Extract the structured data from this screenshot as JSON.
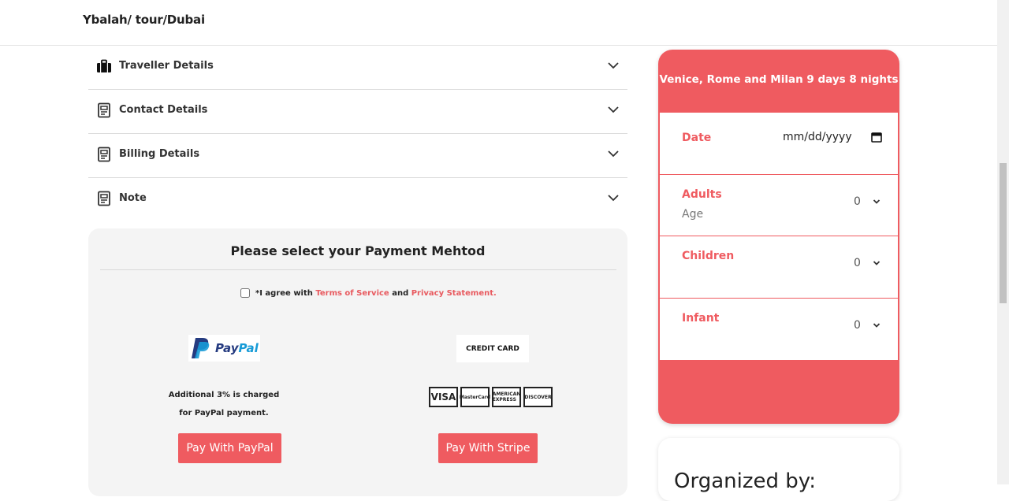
{
  "header": {
    "breadcrumb": "Ybalah/ tour/Dubai"
  },
  "accordion": [
    {
      "label": "Traveller Details",
      "icon": "suitcase-icon"
    },
    {
      "label": "Contact Details",
      "icon": "document-icon"
    },
    {
      "label": "Billing Details",
      "icon": "document-icon"
    },
    {
      "label": "Note",
      "icon": "document-icon"
    }
  ],
  "payment": {
    "title": "Please select your Payment Mehtod",
    "agree_prefix": "*I agree with",
    "terms_link": "Terms of Service",
    "and": "and",
    "privacy_link": "Privacy Statement.",
    "paypal_logo_pay": "Pay",
    "paypal_logo_pal": "Pal",
    "paypal_note_line1": "Additional 3% is charged",
    "paypal_note_line2": "for PayPal payment.",
    "credit_card_label": "CREDIT CARD",
    "card_logos": [
      "VISA",
      "MasterCard",
      "AMERICAN EXPRESS",
      "DISCOVER"
    ],
    "pay_paypal_button": "Pay With PayPal",
    "pay_stripe_button": "Pay With Stripe"
  },
  "booking": {
    "title": "Venice, Rome and Milan 9 days 8 nights",
    "date_label": "Date",
    "date_placeholder": "mm/dd/yyyy",
    "adults_label": "Adults",
    "adults_sub": "Age",
    "adults_value": "0",
    "children_label": "Children",
    "children_value": "0",
    "infant_label": "Infant",
    "infant_value": "0"
  },
  "organizer": {
    "title": "Organized by:"
  },
  "colors": {
    "accent": "#ef5b60",
    "card_bg": "#f4f4f4"
  }
}
